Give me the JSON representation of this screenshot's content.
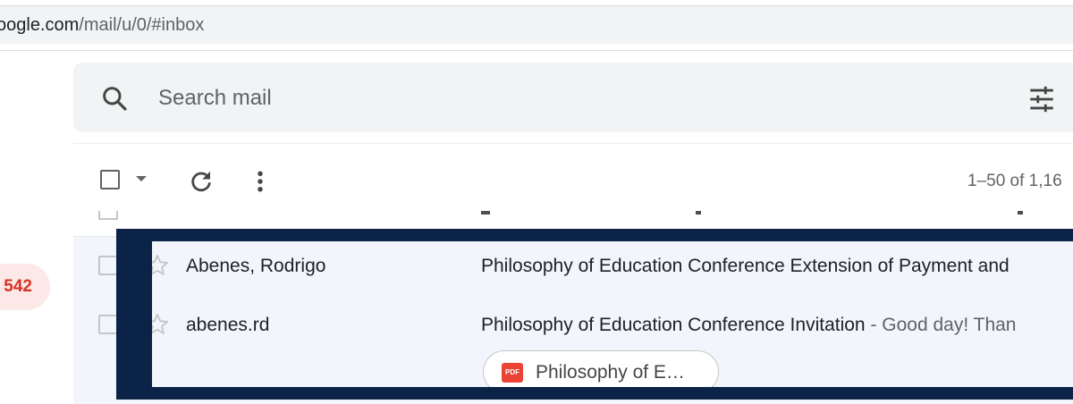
{
  "browser": {
    "url_host": "oogle.com",
    "url_path": "/mail/u/0/#inbox"
  },
  "search": {
    "placeholder": "Search mail",
    "icon": "search-icon",
    "options_icon": "tune-icon"
  },
  "toolbar": {
    "pagination": "1–50 of 1,16"
  },
  "sidebar": {
    "inbox_count": "542"
  },
  "emails": [
    {
      "sender": "Abenes, Rodrigo",
      "subject": "Philosophy of Education Conference Extension of Payment and",
      "snippet": ""
    },
    {
      "sender": "abenes.rd",
      "subject": "Philosophy of Education Conference Invitation",
      "snippet": " - Good day! Than",
      "attachment": {
        "type": "PDF",
        "name": "Philosophy of E…"
      }
    }
  ],
  "colors": {
    "overlay_frame": "#0a2347",
    "badge_text": "#d93025",
    "badge_bg": "#fce8e6",
    "row_read_bg": "#f2f6fc"
  }
}
